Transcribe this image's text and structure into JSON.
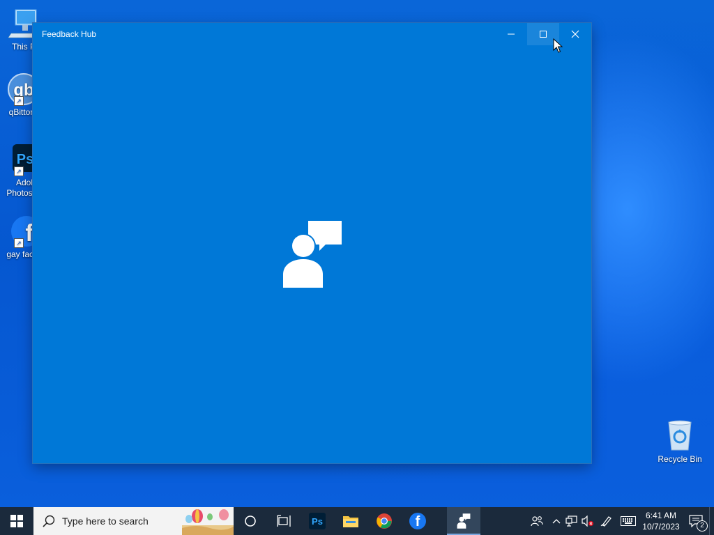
{
  "desktop": {
    "icons": [
      {
        "label": "This P",
        "icon": "computer-icon"
      },
      {
        "label": "qBittor",
        "icon": "qbittorrent-icon"
      },
      {
        "label": "Adob… Photos…",
        "line1": "Adob",
        "line2": "Photos",
        "icon": "photoshop-icon"
      },
      {
        "label": "gay face",
        "icon": "facebook-icon"
      },
      {
        "label": "Recycle Bin",
        "icon": "recycle-bin-icon"
      }
    ]
  },
  "window": {
    "title": "Feedback Hub",
    "splash_icon": "feedback-hub-logo-icon",
    "background_color": "#0078d7",
    "controls": {
      "minimize": "minimize-icon",
      "maximize": "maximize-icon",
      "close": "close-icon"
    }
  },
  "taskbar": {
    "start_icon": "windows-logo-icon",
    "search": {
      "placeholder": "Type here to search"
    },
    "pinned": [
      {
        "name": "cortana",
        "icon": "cortana-circle-icon"
      },
      {
        "name": "task-view",
        "icon": "task-view-icon"
      },
      {
        "name": "photoshop",
        "icon": "photoshop-icon",
        "text": "Ps"
      },
      {
        "name": "file-explorer",
        "icon": "folder-icon"
      },
      {
        "name": "chrome",
        "icon": "chrome-icon"
      },
      {
        "name": "facebook",
        "icon": "facebook-icon",
        "text": "f"
      },
      {
        "name": "feedback-hub",
        "icon": "feedback-hub-icon",
        "active": true
      }
    ],
    "tray": {
      "people_icon": "people-icon",
      "overflow_icon": "chevron-up-icon",
      "network_icon": "network-icon",
      "volume_icon": "volume-muted-icon",
      "pen_icon": "pen-icon",
      "keyboard_icon": "touch-keyboard-icon",
      "time": "6:41 AM",
      "date": "10/7/2023",
      "notifications_icon": "action-center-icon",
      "notification_count": "2"
    }
  }
}
